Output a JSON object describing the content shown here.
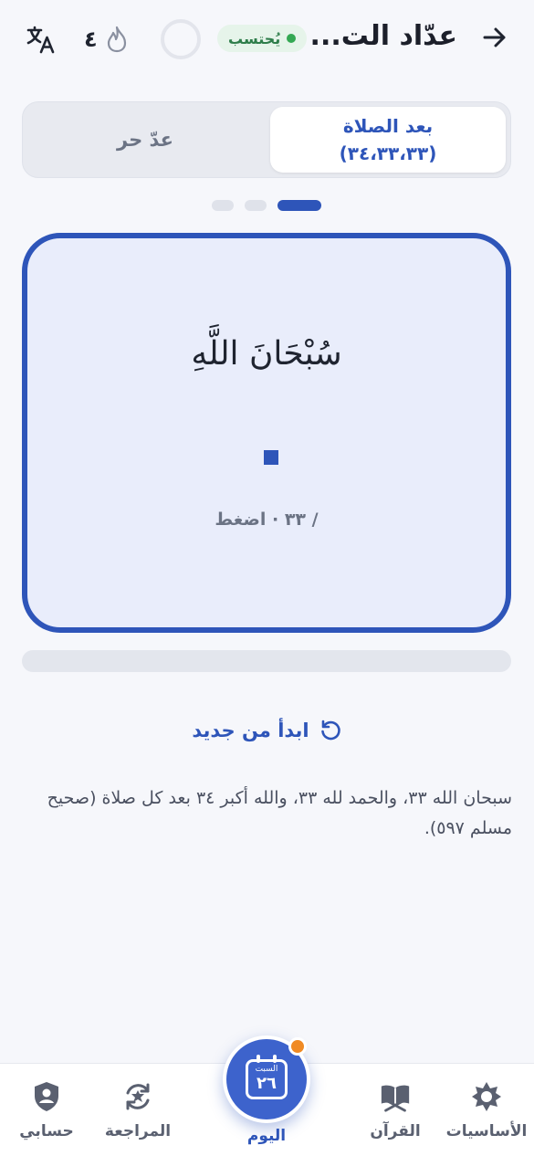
{
  "header": {
    "title": "عدّاد الت...",
    "status": "يُحتسب",
    "streak_count": "٤",
    "icons": {
      "back": "arrow-right-icon",
      "streak": "flame-icon",
      "translate": "translate-icon"
    }
  },
  "mode_toggle": {
    "active_line1": "بعد الصلاة",
    "active_line2": "(٣٤،٣٣،٣٣)",
    "inactive": "عدّ حر"
  },
  "pager": {
    "count": 3,
    "active_index": 0
  },
  "counter": {
    "dhikr": "سُبْحَانَ اللَّهِ",
    "hint": "/ ٣٣ · اضغط"
  },
  "progress": {
    "value": 0
  },
  "restart": {
    "label": "ابدأ من جديد",
    "icon": "restart-icon"
  },
  "hadith": "سبحان الله ٣٣، والحمد لله ٣٣، والله أكبر ٣٤ بعد كل صلاة (صحيح مسلم ٥٩٧).",
  "bottom_nav": {
    "basics": "الأساسيات",
    "quran": "القرآن",
    "today": "اليوم",
    "today_day": "السبت",
    "today_date": "٢٦",
    "review": "المراجعة",
    "account": "حسابي"
  },
  "colors": {
    "accent": "#2e55b9",
    "badge": "#f08a24",
    "status_green": "#34a853"
  }
}
